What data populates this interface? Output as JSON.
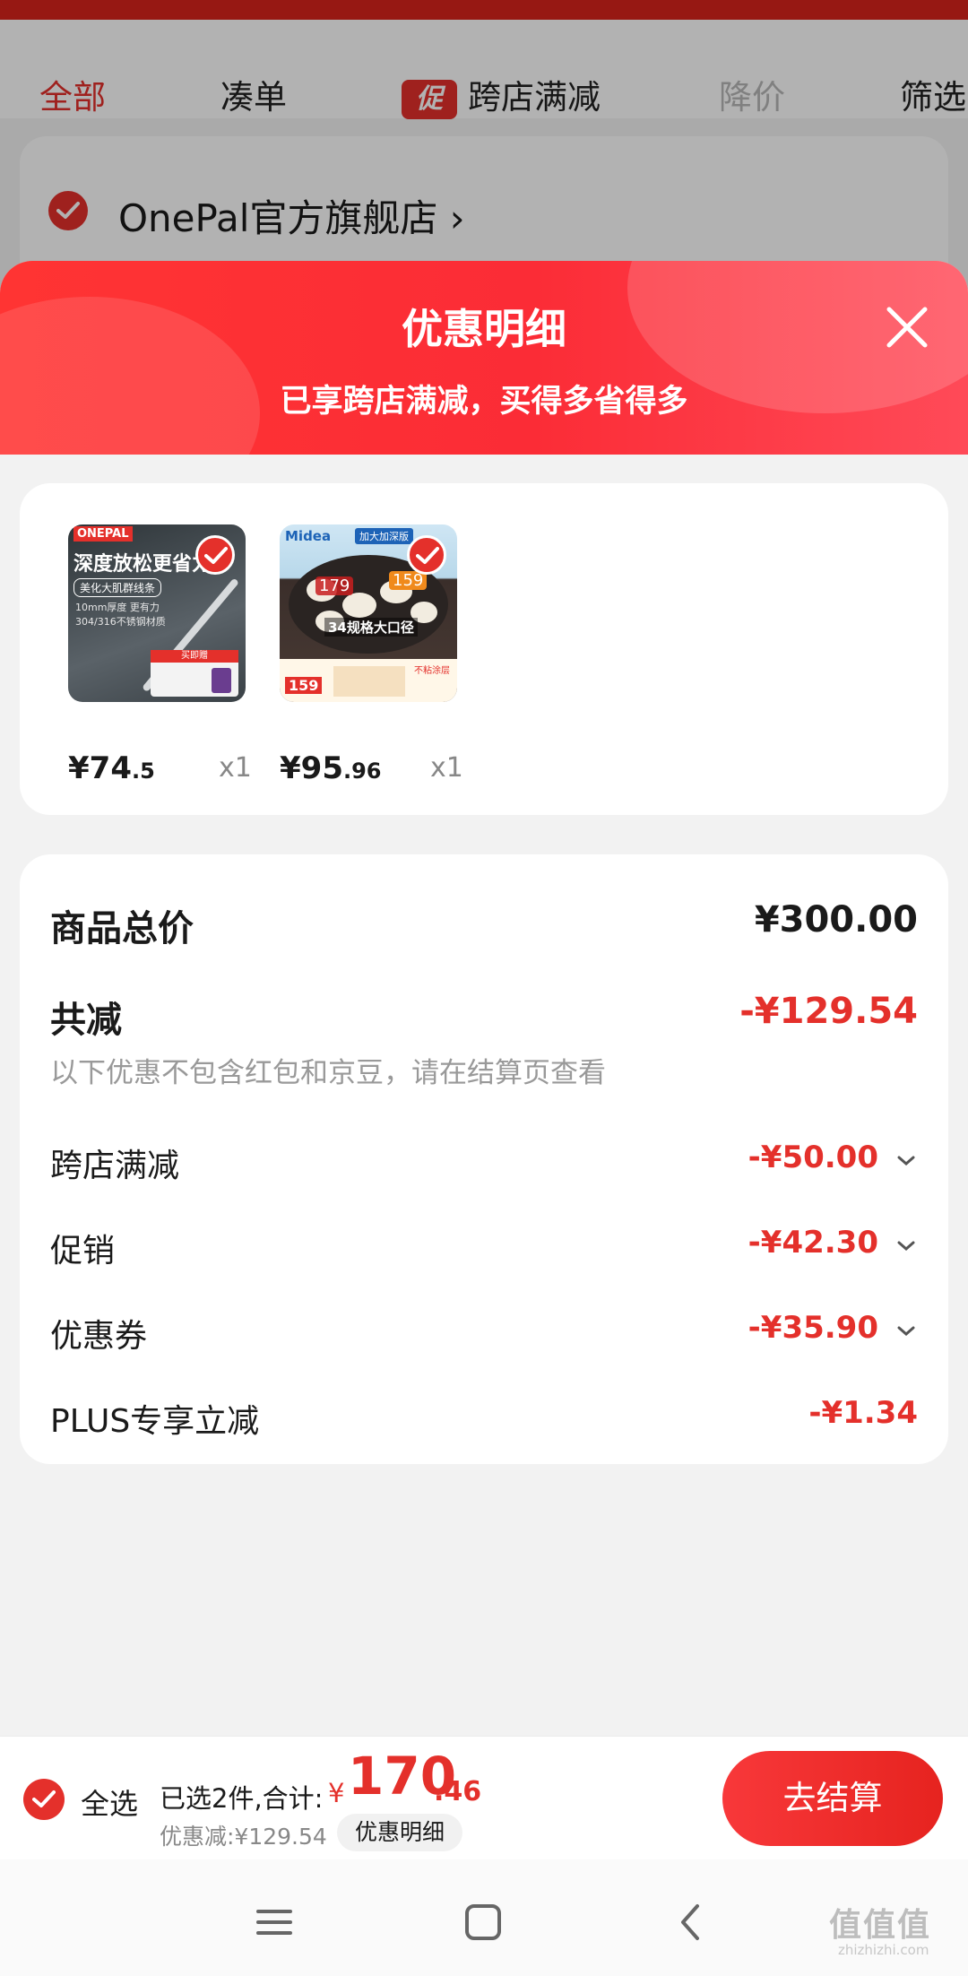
{
  "background_page": {
    "tabs": [
      {
        "label": "全部",
        "state": "active"
      },
      {
        "label": "凑单",
        "state": "normal"
      },
      {
        "label": "跨店满减",
        "state": "normal",
        "badge": "促"
      },
      {
        "label": "降价",
        "state": "muted"
      },
      {
        "label": "筛选",
        "state": "normal"
      }
    ],
    "shop_name": "OnePal官方旗舰店",
    "shop_chevron": "›"
  },
  "sheet": {
    "title": "优惠明细",
    "subtitle": "已享跨店满减，买得多省得多",
    "close_icon": "close-icon"
  },
  "products": [
    {
      "price_int": "¥74",
      "price_dec": ".5",
      "qty": "x1",
      "image": {
        "brand": "ONEPAL",
        "headline": "深度放松更省力",
        "tag": "美化大肌群线条",
        "specs": [
          "10mm厚度 更有力",
          "304/316不锈钢材质"
        ],
        "badge": "买即赠"
      }
    },
    {
      "price_int": "¥95",
      "price_dec": ".96",
      "qty": "x1",
      "image": {
        "brand": "Midea",
        "label": "加大加深版",
        "price_a": "179",
        "price_b": "159",
        "caption": "34规格大口径",
        "promo_price": "159",
        "note": "不粘涂层"
      }
    }
  ],
  "summary": {
    "total_label": "商品总价",
    "total_value": "¥300.00",
    "cut_label": "共减",
    "cut_value": "-¥129.54",
    "note": "以下优惠不包含红包和京豆，请在结算页查看",
    "details": [
      {
        "label": "跨店满减",
        "value": "-¥50.00",
        "expandable": true
      },
      {
        "label": "促销",
        "value": "-¥42.30",
        "expandable": true
      },
      {
        "label": "优惠券",
        "value": "-¥35.90",
        "expandable": true
      },
      {
        "label": "PLUS专享立减",
        "value": "-¥1.34",
        "expandable": false
      }
    ]
  },
  "bottom_bar": {
    "select_all": "全选",
    "selected_text": "已选2件,合计:",
    "currency": "¥",
    "amount_int": "170",
    "amount_dec": ".46",
    "discount_text": "优惠减:¥129.54",
    "detail_button": "优惠明细",
    "checkout_button": "去结算"
  },
  "system_nav": [
    "menu-icon",
    "home-square-icon",
    "back-chevron-icon"
  ],
  "watermark": {
    "text": "值值值",
    "sub": "zhizhizhi.com"
  },
  "colors": {
    "accent": "#e4302b",
    "header_red": "#fb2c36",
    "muted": "#999999"
  }
}
